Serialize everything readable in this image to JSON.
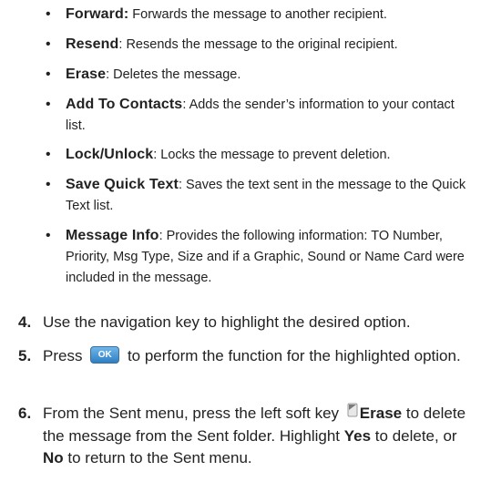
{
  "bullets": [
    {
      "term": "Forward:",
      "desc": " Forwards the message to another recipient."
    },
    {
      "term": "Resend",
      "desc": ": Resends the message to the original recipient."
    },
    {
      "term": "Erase",
      "desc": ": Deletes the message."
    },
    {
      "term": "Add To Contacts",
      "desc": ": Adds the sender’s information to your contact list."
    },
    {
      "term": "Lock/Unlock",
      "desc": ": Locks the message to prevent deletion."
    },
    {
      "term": "Save Quick Text",
      "desc": ": Saves the text sent in the message to the Quick Text list."
    },
    {
      "term": "Message Info",
      "desc": ": Provides the following information: TO Number, Priority, Msg Type, Size and if a Graphic, Sound or Name Card were included in the message."
    }
  ],
  "steps": {
    "s4": {
      "num": "4.",
      "text": "Use the navigation key to highlight the desired option."
    },
    "s5": {
      "num": "5.",
      "pre": "Press",
      "post": "to perform the function for the highlighted option."
    },
    "s6": {
      "num": "6.",
      "a": "From the Sent menu, press the left soft key",
      "key": "Erase",
      "b": "to delete the message from the Sent folder. Highlight",
      "yes": "Yes",
      "c": "to delete, or",
      "no": "No",
      "d": "to return to the Sent menu."
    }
  },
  "icons": {
    "ok_button": "OK",
    "ok_color": "#3d8fd6",
    "softkey": "left-soft-key-icon"
  }
}
